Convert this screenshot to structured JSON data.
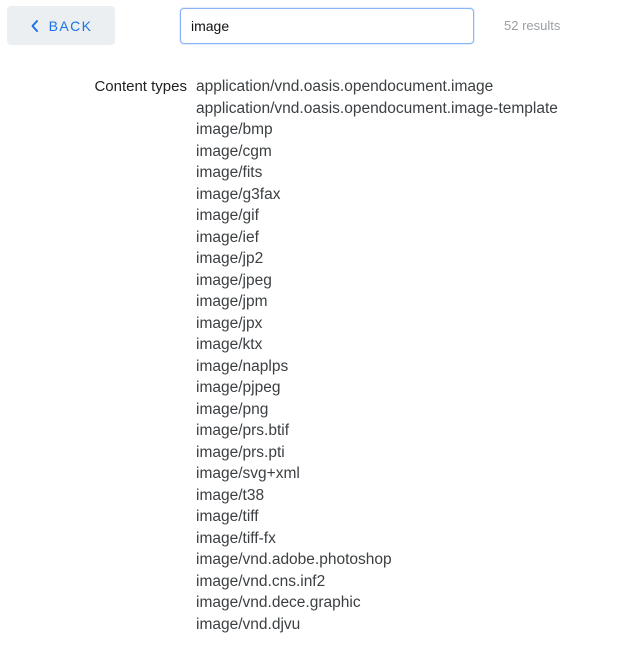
{
  "header": {
    "back_label": "BACK",
    "search_value": "image",
    "result_count": "52 results"
  },
  "content": {
    "section_label": "Content types",
    "types": [
      "application/vnd.oasis.opendocument.image",
      "application/vnd.oasis.opendocument.image-template",
      "image/bmp",
      "image/cgm",
      "image/fits",
      "image/g3fax",
      "image/gif",
      "image/ief",
      "image/jp2",
      "image/jpeg",
      "image/jpm",
      "image/jpx",
      "image/ktx",
      "image/naplps",
      "image/pjpeg",
      "image/png",
      "image/prs.btif",
      "image/prs.pti",
      "image/svg+xml",
      "image/t38",
      "image/tiff",
      "image/tiff-fx",
      "image/vnd.adobe.photoshop",
      "image/vnd.cns.inf2",
      "image/vnd.dece.graphic",
      "image/vnd.djvu"
    ]
  },
  "colors": {
    "accent": "#1a73e8",
    "button_bg": "#eceff1",
    "input_border": "#8ab4f8",
    "muted_text": "#9aa0a6"
  },
  "icons": {
    "back": "chevron-left-icon"
  }
}
